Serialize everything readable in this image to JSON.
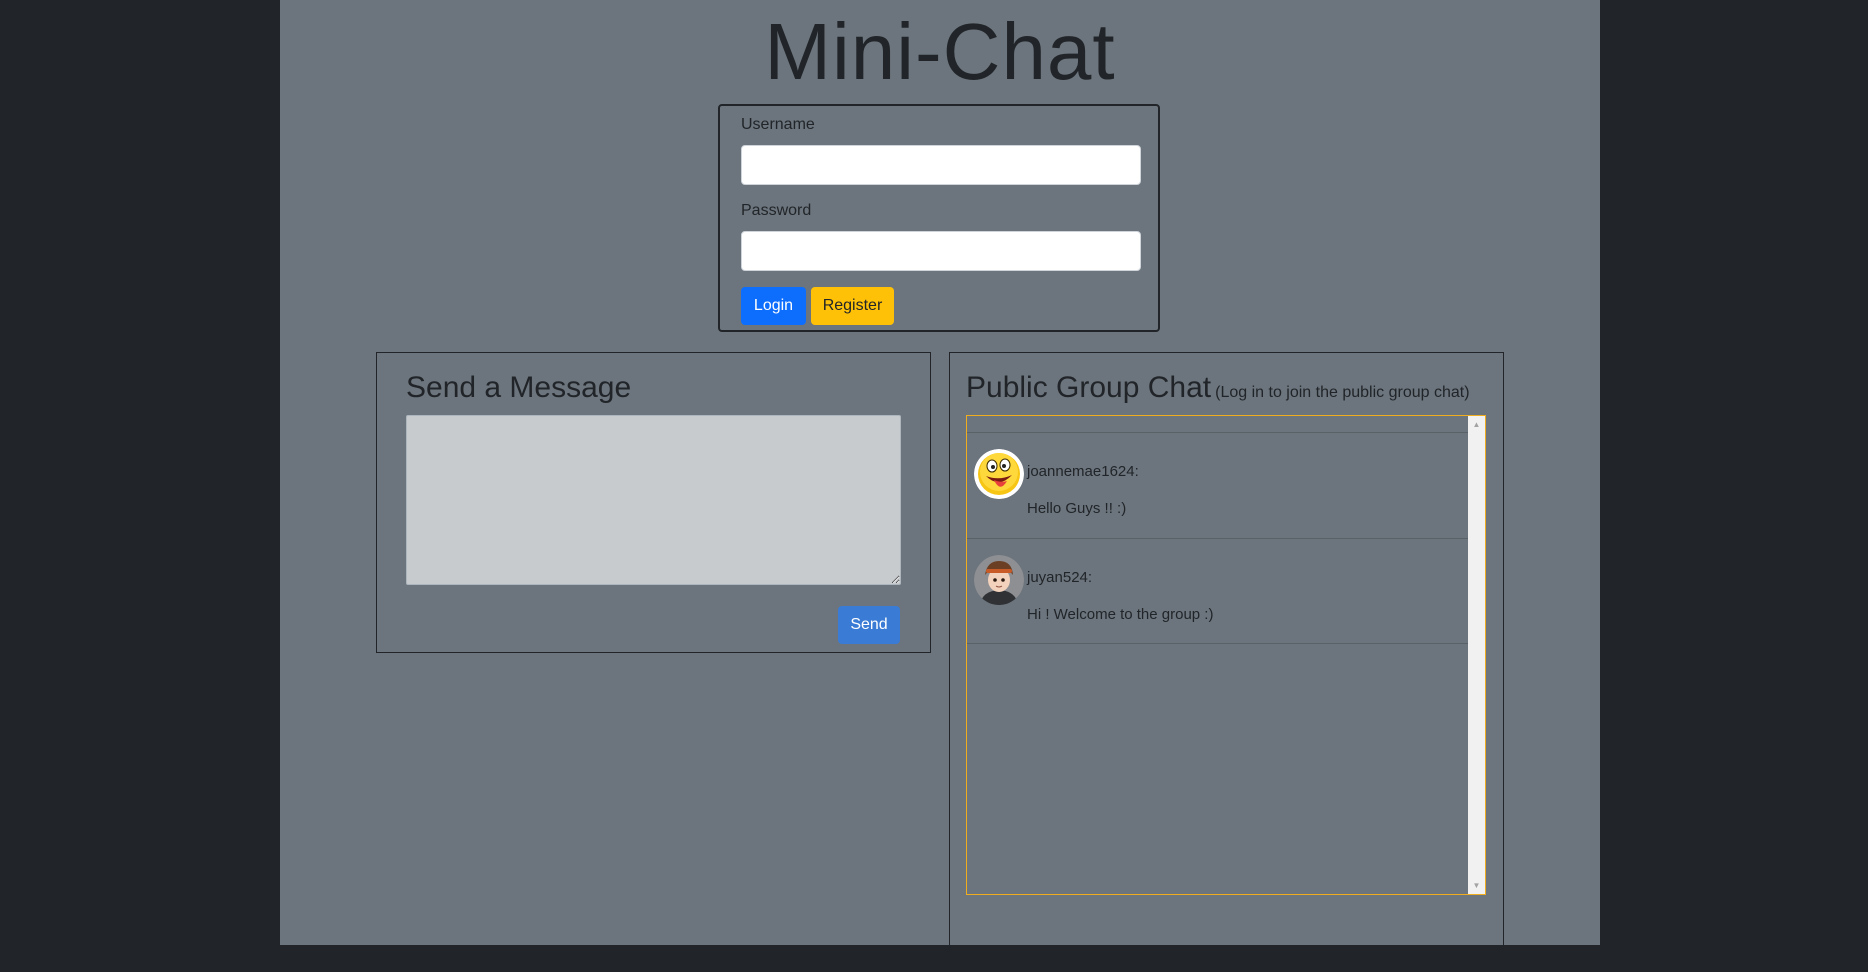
{
  "app": {
    "title": "Mini-Chat"
  },
  "login": {
    "username_label": "Username",
    "username_value": "",
    "password_label": "Password",
    "password_value": "",
    "login_label": "Login",
    "register_label": "Register"
  },
  "send": {
    "title": "Send a Message",
    "message_value": "",
    "send_label": "Send"
  },
  "chat": {
    "title": "Public Group Chat",
    "subtitle": "(Log in to join the public group chat)",
    "messages": [
      {
        "user": "joannemae1624:",
        "text": "Hello Guys !! :)",
        "avatar": "laughing-emoji-icon"
      },
      {
        "user": "juyan524:",
        "text": "Hi ! Welcome to the group :)",
        "avatar": "anime-boy-avatar"
      }
    ]
  },
  "colors": {
    "outer_bg": "#212529",
    "page_bg": "#6c757d",
    "login_button": "#0d6efd",
    "register_button": "#ffc107",
    "send_button": "#3a7bd5",
    "chat_border": "#f0ad1e"
  }
}
